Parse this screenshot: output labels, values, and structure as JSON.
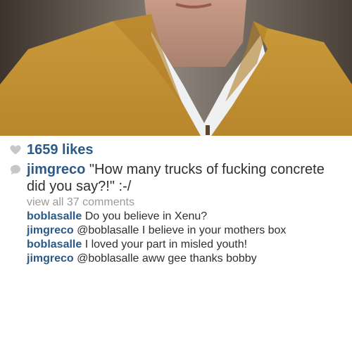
{
  "post": {
    "likes_count": "1659 likes",
    "caption": {
      "username": "jimgreco",
      "text": "\"How many trucks of fucking concrete did you say?!\" :-/"
    },
    "view_all_label": "view all 37 comments",
    "comments": [
      {
        "username": "boblasalle",
        "text": "Do you believe in Xenu?"
      },
      {
        "username": "jimgreco",
        "text": "@boblasalle I believe in your mothers box"
      },
      {
        "username": "boblasalle",
        "text": "I loved your part in misled youth!"
      },
      {
        "username": "jimgreco",
        "text": "@boblasalle aww gee thanks bobby"
      }
    ]
  },
  "icons": {
    "likes": "heart-icon",
    "caption": "comment-bubble-icon"
  },
  "colors": {
    "username": "#2b5a86",
    "muted": "#9a9a9a",
    "text": "#2f2f2f",
    "icon": "#c7c7c7"
  }
}
